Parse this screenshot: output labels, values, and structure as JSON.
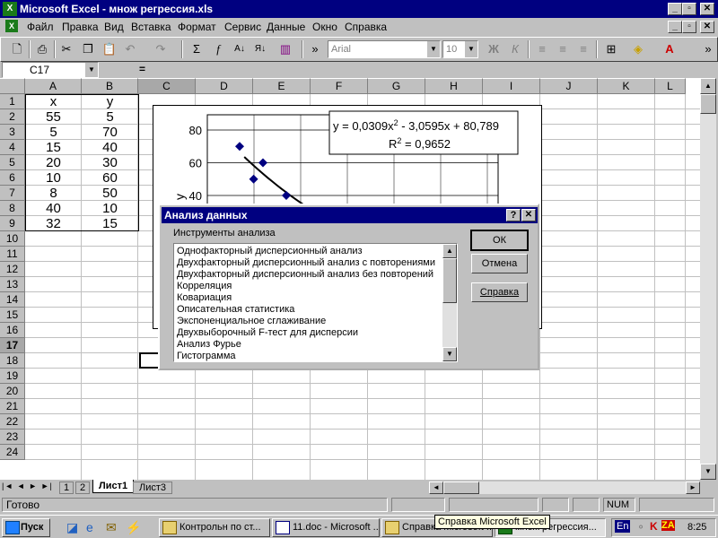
{
  "window": {
    "title": "Microsoft Excel - множ регрессия.xls"
  },
  "menu": [
    "Файл",
    "Правка",
    "Вид",
    "Вставка",
    "Формат",
    "Сервис",
    "Данные",
    "Окно",
    "Справка"
  ],
  "toolbar": {
    "font": "Arial",
    "size": "10"
  },
  "formula_bar": {
    "cell_ref": "C17",
    "equals": "="
  },
  "columns": [
    "A",
    "B",
    "C",
    "D",
    "E",
    "F",
    "G",
    "H",
    "I",
    "J",
    "K",
    "L"
  ],
  "rows": [
    "1",
    "2",
    "3",
    "4",
    "5",
    "6",
    "7",
    "8",
    "9",
    "10",
    "11",
    "12",
    "13",
    "14",
    "15",
    "16",
    "17",
    "18",
    "19",
    "20",
    "21",
    "22",
    "23",
    "24"
  ],
  "table": {
    "headers": [
      "x",
      "y"
    ],
    "rows": [
      [
        "55",
        "5"
      ],
      [
        "5",
        "70"
      ],
      [
        "15",
        "40"
      ],
      [
        "20",
        "30"
      ],
      [
        "10",
        "60"
      ],
      [
        "8",
        "50"
      ],
      [
        "40",
        "10"
      ],
      [
        "32",
        "15"
      ]
    ]
  },
  "chart_data": {
    "type": "scatter",
    "ylabel": "y",
    "yticks": [
      "80",
      "60",
      "40"
    ],
    "ylim": [
      40,
      80
    ],
    "points": [
      {
        "x": 5,
        "y": 70
      },
      {
        "x": 8,
        "y": 50
      },
      {
        "x": 10,
        "y": 60
      },
      {
        "x": 15,
        "y": 40
      }
    ],
    "equation_main": "y = 0,0309x",
    "equation_sup": "2",
    "equation_rest": " - 3,0595x + 80,789",
    "r2_main": "R",
    "r2_sup": "2",
    "r2_rest": " = 0,9652",
    "colors": {
      "marker": "#000080",
      "trend": "#000000"
    }
  },
  "dialog": {
    "title": "Анализ данных",
    "help_q": "?",
    "group_label": "Инструменты анализа",
    "ok": "ОК",
    "cancel": "Отмена",
    "help": "Справка",
    "items": [
      "Однофакторный дисперсионный анализ",
      "Двухфакторный дисперсионный анализ с повторениями",
      "Двухфакторный дисперсионный анализ без повторений",
      "Корреляция",
      "Ковариация",
      "Описательная статистика",
      "Экспоненциальное сглаживание",
      "Двухвыборочный F-тест для дисперсии",
      "Анализ Фурье",
      "Гистограмма"
    ]
  },
  "sheets": [
    "1",
    "2",
    "Лист1",
    "Лист3"
  ],
  "status": {
    "text": "Готово",
    "num": "NUM"
  },
  "taskbar": {
    "start": "Пуск",
    "items": [
      "Контрольн по ст...",
      "11.doc - Microsoft ...",
      "Справка Microsoft ...",
      "множ регрессия..."
    ],
    "tooltip": "Справка Microsoft Excel",
    "lang": "En",
    "time": "8:25"
  }
}
